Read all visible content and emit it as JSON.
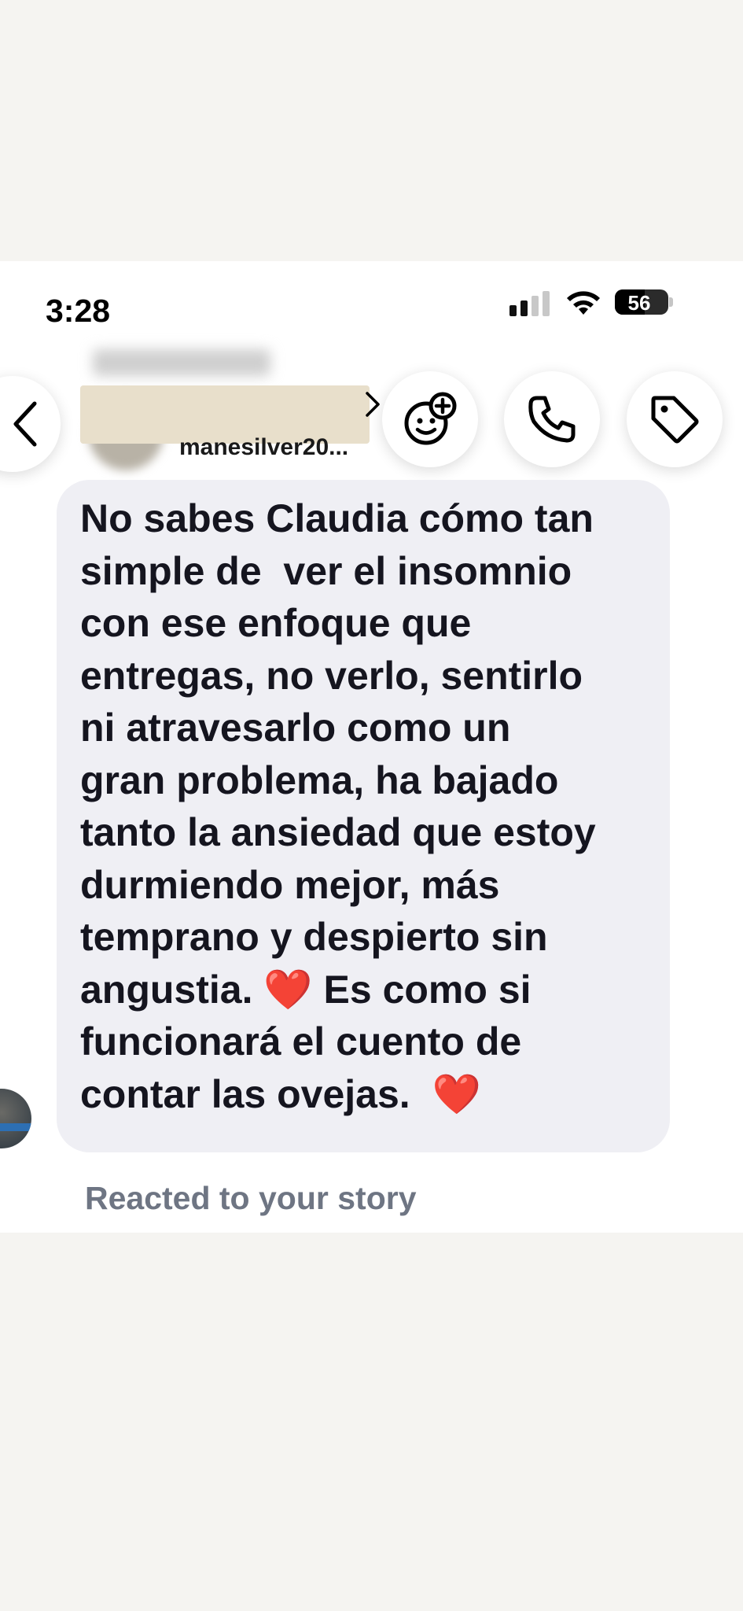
{
  "status_bar": {
    "time": "3:28",
    "battery_level": "56",
    "battery_fraction": 0.56
  },
  "header": {
    "username": "manesilver20...",
    "buttons": [
      "back",
      "video-effects",
      "call",
      "tag"
    ]
  },
  "message": {
    "lines": [
      "No sabes Claudia cómo tan",
      "simple de  ver el insomnio",
      "con ese enfoque que",
      "entregas, no verlo, sentirlo",
      "ni atravesarlo como un",
      "gran problema, ha bajado",
      "tanto la ansiedad que estoy",
      "durmiendo mejor, más",
      "temprano y despierto sin"
    ],
    "line10_before": "angustia. ",
    "line10_heart": "❤️",
    "line10_after": " Es como si",
    "line11": "funcionará el cuento de",
    "line12_text": "contar las ovejas.  ",
    "line12_heart": "❤️"
  },
  "story_note": "Reacted to your story",
  "colors": {
    "bubble": "#efeff4",
    "note_gray": "#6e7583",
    "heart": "#e0171b"
  }
}
